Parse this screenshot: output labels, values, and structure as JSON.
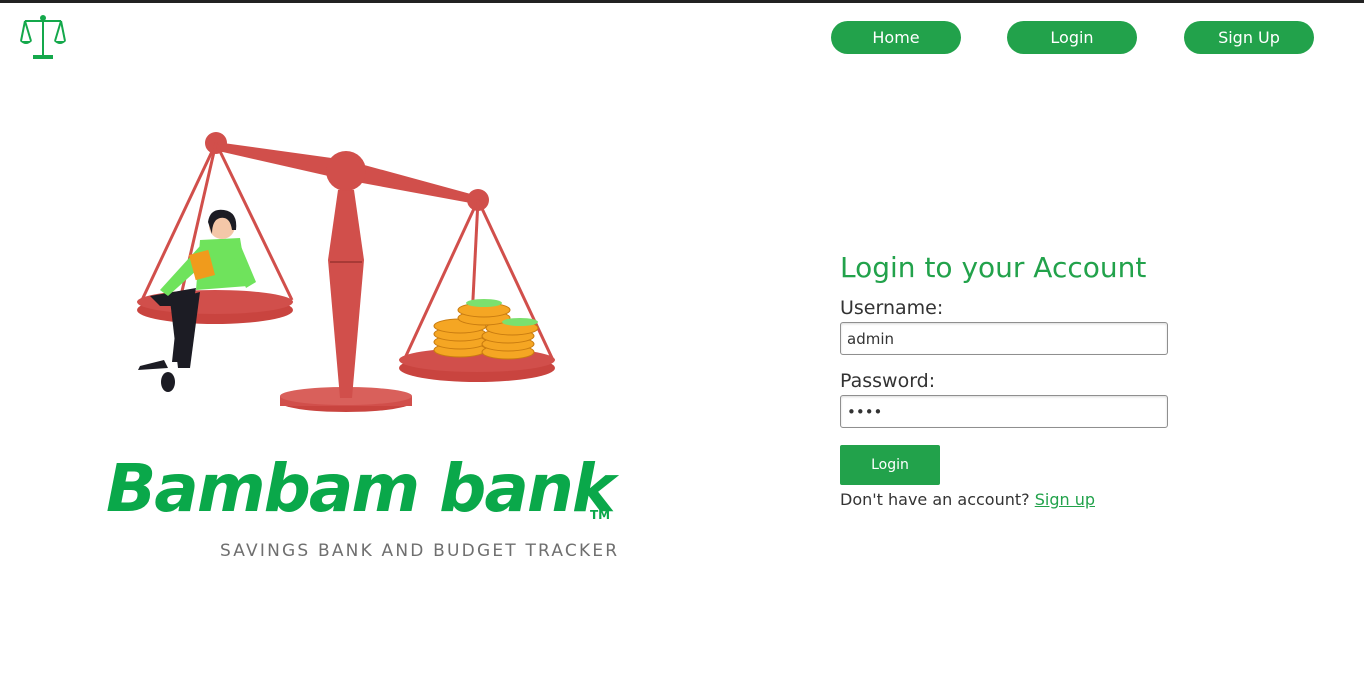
{
  "nav": {
    "home_label": "Home",
    "login_label": "Login",
    "signup_label": "Sign Up"
  },
  "brand": {
    "name": "Bambam bank",
    "trademark": "TM",
    "tagline": "SAVINGS BANK AND BUDGET TRACKER"
  },
  "login_form": {
    "title": "Login to your Account",
    "username_label": "Username:",
    "username_value": "admin",
    "password_label": "Password:",
    "password_value": "••••",
    "submit_label": "Login",
    "signup_prompt": "Don't have an account?",
    "signup_link": "Sign up"
  },
  "colors": {
    "accent": "#22a24b",
    "brand_green": "#0aa84a",
    "scale_red": "#d14f4b",
    "coin_gold": "#f5a623"
  },
  "icons": {
    "nav_logo": "balance-scale-icon"
  }
}
